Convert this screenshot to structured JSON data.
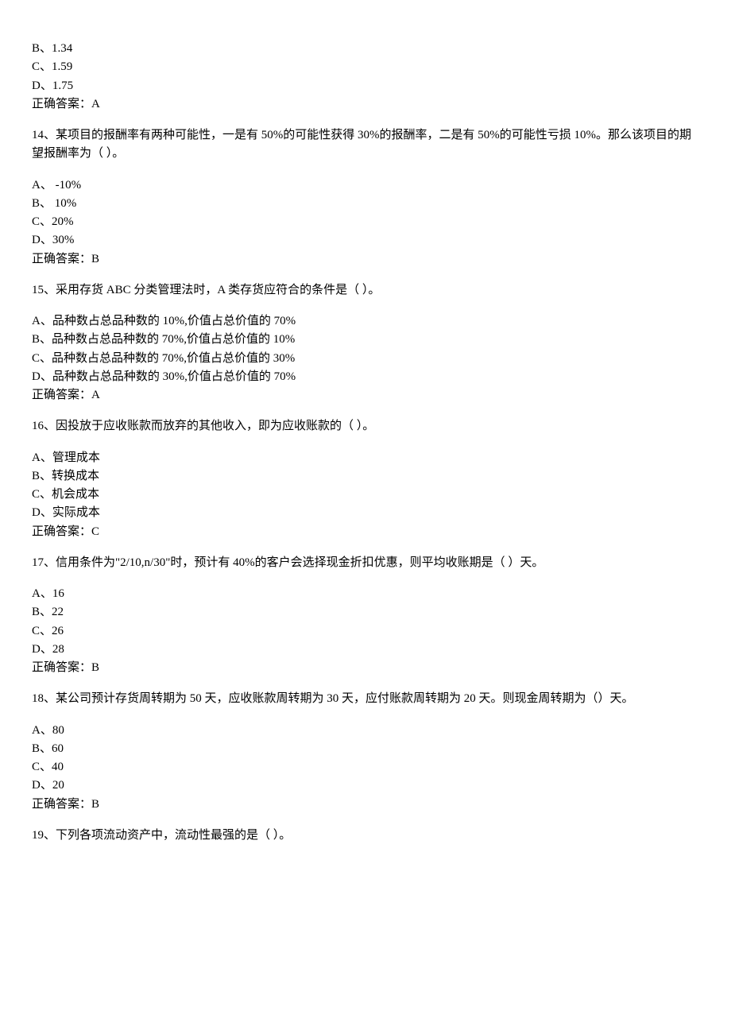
{
  "prevTail": {
    "opts": [
      "B、1.34",
      "C、1.59",
      "D、1.75"
    ],
    "ans": "正确答案：A"
  },
  "q14": {
    "stem": "14、某项目的报酬率有两种可能性，一是有 50%的可能性获得 30%的报酬率，二是有 50%的可能性亏损 10%。那么该项目的期望报酬率为（    ）。",
    "opts": [
      "A、  -10%",
      "B、  10%",
      "C、20%",
      "D、30%"
    ],
    "ans": "正确答案：B"
  },
  "q15": {
    "stem": "15、采用存货 ABC 分类管理法时，A 类存货应符合的条件是（    ）。",
    "opts": [
      "A、品种数占总品种数的 10%,价值占总价值的 70%",
      "B、品种数占总品种数的 70%,价值占总价值的 10%",
      "C、品种数占总品种数的 70%,价值占总价值的 30%",
      "D、品种数占总品种数的 30%,价值占总价值的 70%"
    ],
    "ans": "正确答案：A"
  },
  "q16": {
    "stem": "16、因投放于应收账款而放弃的其他收入，即为应收账款的（    ）。",
    "opts": [
      "A、管理成本",
      "B、转换成本",
      "C、机会成本",
      "D、实际成本"
    ],
    "ans": "正确答案：C"
  },
  "q17": {
    "stem": "17、信用条件为\"2/10,n/30\"时，预计有 40%的客户会选择现金折扣优惠，则平均收账期是（   ）天。",
    "opts": [
      "A、16",
      "B、22",
      "C、26",
      "D、28"
    ],
    "ans": "正确答案：B"
  },
  "q18": {
    "stem": "18、某公司预计存货周转期为 50 天，应收账款周转期为 30 天，应付账款周转期为 20 天。则现金周转期为（）天。",
    "opts": [
      "A、80",
      "B、60",
      "C、40",
      "D、20"
    ],
    "ans": "正确答案：B"
  },
  "q19": {
    "stem": "19、下列各项流动资产中，流动性最强的是（    ）。"
  }
}
